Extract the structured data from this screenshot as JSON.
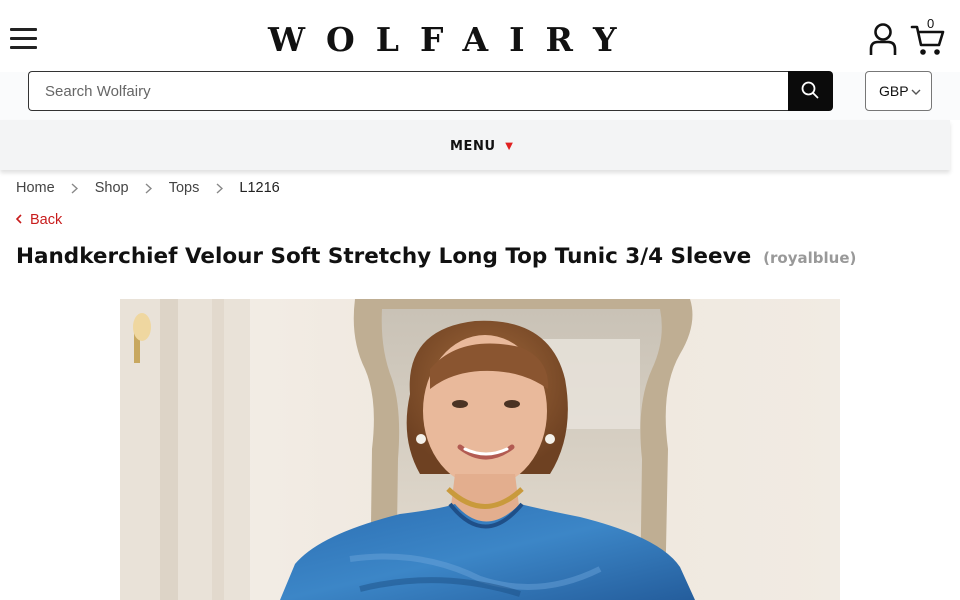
{
  "header": {
    "logo_text": "WOLFAIRY",
    "cart_count": "0"
  },
  "search": {
    "placeholder": "Search Wolfairy",
    "value": ""
  },
  "currency": {
    "selected": "GBP"
  },
  "menu": {
    "label": "MENU",
    "arrow": "▼",
    "arrow_color": "#e02020"
  },
  "breadcrumb": {
    "items": [
      "Home",
      "Shop",
      "Tops"
    ],
    "current": "L1216"
  },
  "back_link": {
    "label": "Back"
  },
  "product": {
    "title": "Handkerchief Velour Soft Stretchy Long Top Tunic 3/4 Sleeve",
    "variant": "(royalblue)"
  },
  "colors": {
    "accent_red": "#c81c1c",
    "search_button": "#0b0b0b",
    "menu_bar_bg": "#f3f4f5"
  },
  "icons": [
    "hamburger-menu-icon",
    "account-icon",
    "cart-icon",
    "search-icon",
    "chevron-down-icon",
    "chevron-right-icon",
    "chevron-left-icon"
  ]
}
